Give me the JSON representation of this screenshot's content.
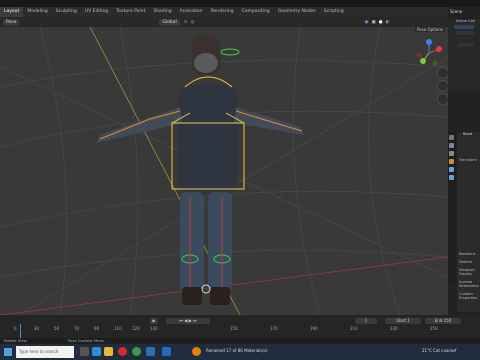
{
  "workspace_tabs": [
    "Layout",
    "Modeling",
    "Sculpting",
    "UV Editing",
    "Texture Paint",
    "Shading",
    "Animation",
    "Rendering",
    "Compositing",
    "Geometry Nodes",
    "Scripting"
  ],
  "active_tab": "Layout",
  "viewport_header": {
    "mode": "Pose",
    "orientation": "Global",
    "options": "Pose Options"
  },
  "scene": {
    "name": "Scene",
    "outliner_title": "Scene Coll"
  },
  "properties": {
    "title": "Bone",
    "items": [
      "Transform",
      "Relations",
      "Deform",
      "Viewport Display",
      "Inverse Kinematics",
      "Custom Properties"
    ]
  },
  "timeline": {
    "frame_labels": [
      "0",
      "30",
      "50",
      "70",
      "90",
      "110",
      "120",
      "130",
      "150",
      "170",
      "190",
      "210",
      "230",
      "250"
    ],
    "current_frame": "1",
    "start_label": "Start",
    "start_frame": "1",
    "end_label": "End",
    "end_frame": "250"
  },
  "status": {
    "left": "Rotate View",
    "mid": "Pose Context Menu"
  },
  "taskbar": {
    "search": "Type here to search",
    "notification": "Renamed 17 of 86 Materials(s)",
    "weather": "21°C Cat cuaraef",
    "time": "12:00"
  },
  "colors": {
    "accent": "#e08a2c",
    "select": "#f5c542",
    "bone_green": "#44c84a"
  }
}
